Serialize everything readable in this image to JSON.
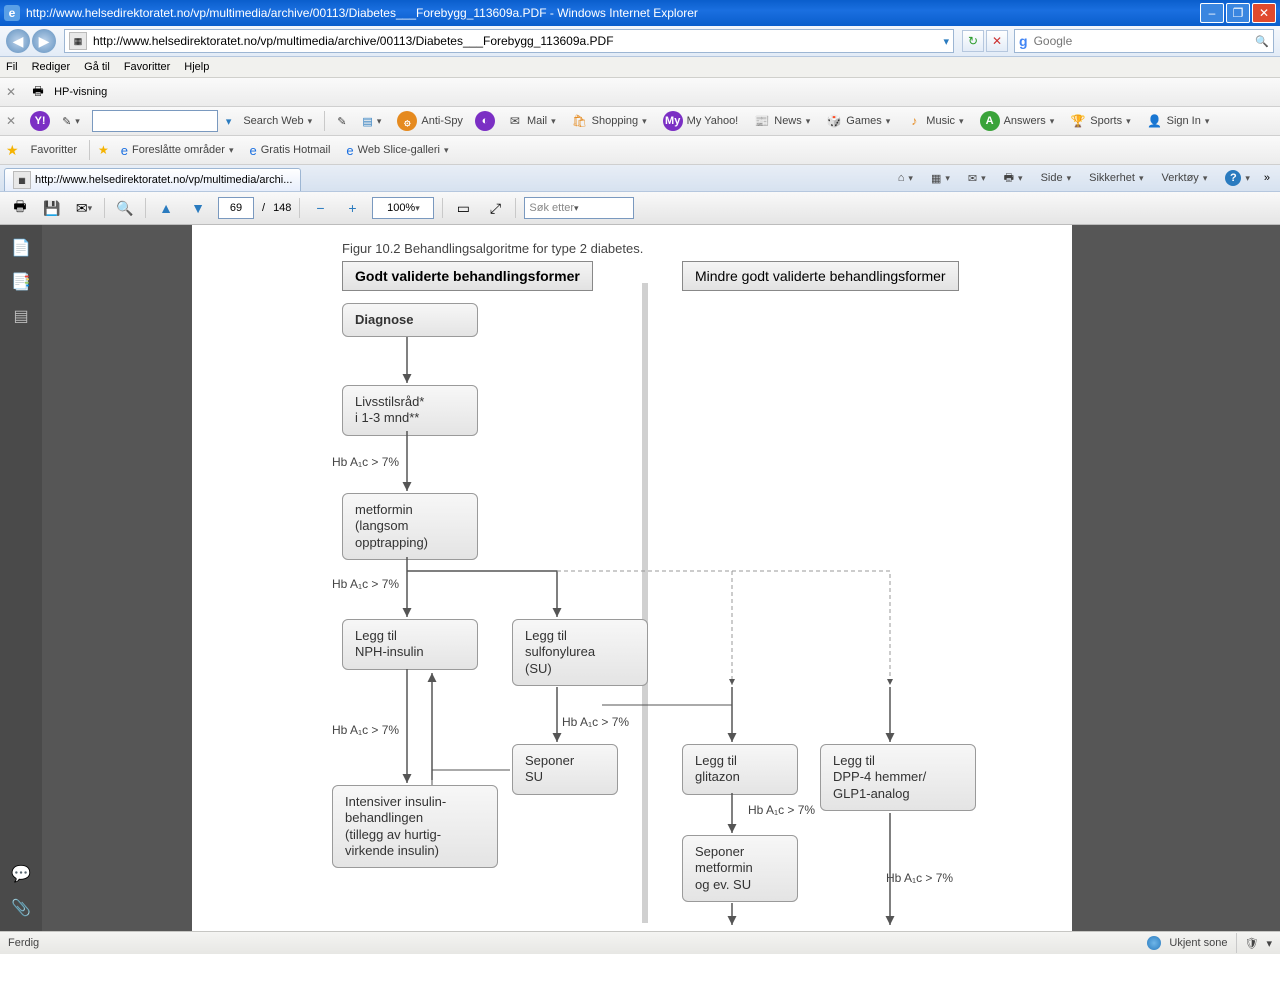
{
  "window": {
    "title": "http://www.helsedirektoratet.no/vp/multimedia/archive/00113/Diabetes___Forebygg_113609a.PDF - Windows Internet Explorer",
    "min": "–",
    "max": "❐",
    "close": "✕"
  },
  "nav": {
    "back": "◀",
    "fwd": "▶",
    "url": "http://www.helsedirektoratet.no/vp/multimedia/archive/00113/Diabetes___Forebygg_113609a.PDF",
    "refresh": "↻",
    "stop": "✕",
    "search_placeholder": "Google",
    "search_go": "🔍"
  },
  "menubar": {
    "file": "Fil",
    "edit": "Rediger",
    "goto": "Gå til",
    "fav": "Favoritter",
    "help": "Hjelp"
  },
  "hp_row": {
    "close": "✕",
    "label": "HP-visning"
  },
  "yahoo_row": {
    "close": "✕",
    "y": "Y!",
    "pencil": "✎",
    "search_btn": "Search Web",
    "antispy": "Anti-Spy",
    "mail": "Mail",
    "shopping": "Shopping",
    "myyahoo": "My Yahoo!",
    "news": "News",
    "games": "Games",
    "music": "Music",
    "answers": "Answers",
    "sports": "Sports",
    "signin": "Sign In"
  },
  "fav_row": {
    "fav_btn": "Favoritter",
    "links": [
      "Foreslåtte områder",
      "Gratis Hotmail",
      "Web Slice-galleri"
    ]
  },
  "tab": {
    "label": "http://www.helsedirektoratet.no/vp/multimedia/archi..."
  },
  "tab_right": {
    "home": "⌂",
    "feed": "▦",
    "mail": "✉",
    "print": "🖶",
    "page": "Side",
    "safety": "Sikkerhet",
    "tools": "Verktøy",
    "help": "?"
  },
  "pdfbar": {
    "print": "🖶",
    "save": "💾",
    "share": "✉",
    "page_current": "69",
    "page_sep": "/",
    "page_total": "148",
    "up": "▲",
    "down": "▼",
    "minus": "−",
    "plus": "+",
    "zoom": "100%",
    "fit": "▭",
    "fit2": "⤢",
    "search_placeholder": "Søk etter"
  },
  "side": {
    "copy": "📄",
    "page": "📑",
    "book": "▤",
    "chat": "💬",
    "attach": "📎"
  },
  "doc": {
    "caption": "Figur 10.2   Behandlingsalgoritme for type 2 diabetes.",
    "col_left": "Godt validerte behandlingsformer",
    "col_right": "Mindre godt validerte behandlingsformer",
    "n_diag": "Diagnose",
    "n_life": "Livsstilsråd*\ni 1-3 mnd**",
    "n_met": "metformin\n(langsom\nopptrapping)",
    "n_nph": "Legg til\nNPH-insulin",
    "n_su": "Legg til\nsulfonylurea\n(SU)",
    "n_sep_su": "Seponer\nSU",
    "n_intens": "Intensiver insulin-\nbehandlingen\n(tillegg av hurtig-\nvirkende insulin)",
    "n_glit": "Legg til\nglitazon",
    "n_dpp": "Legg til\nDPP-4 hemmer/\nGLP1-analog",
    "n_sep_met": "Seponer\nmetformin\nog ev. SU",
    "hba1c": "Hb A₁c > 7%"
  },
  "status": {
    "left": "Ferdig",
    "zone": "Ukjent sone",
    "shield": "🛡"
  }
}
